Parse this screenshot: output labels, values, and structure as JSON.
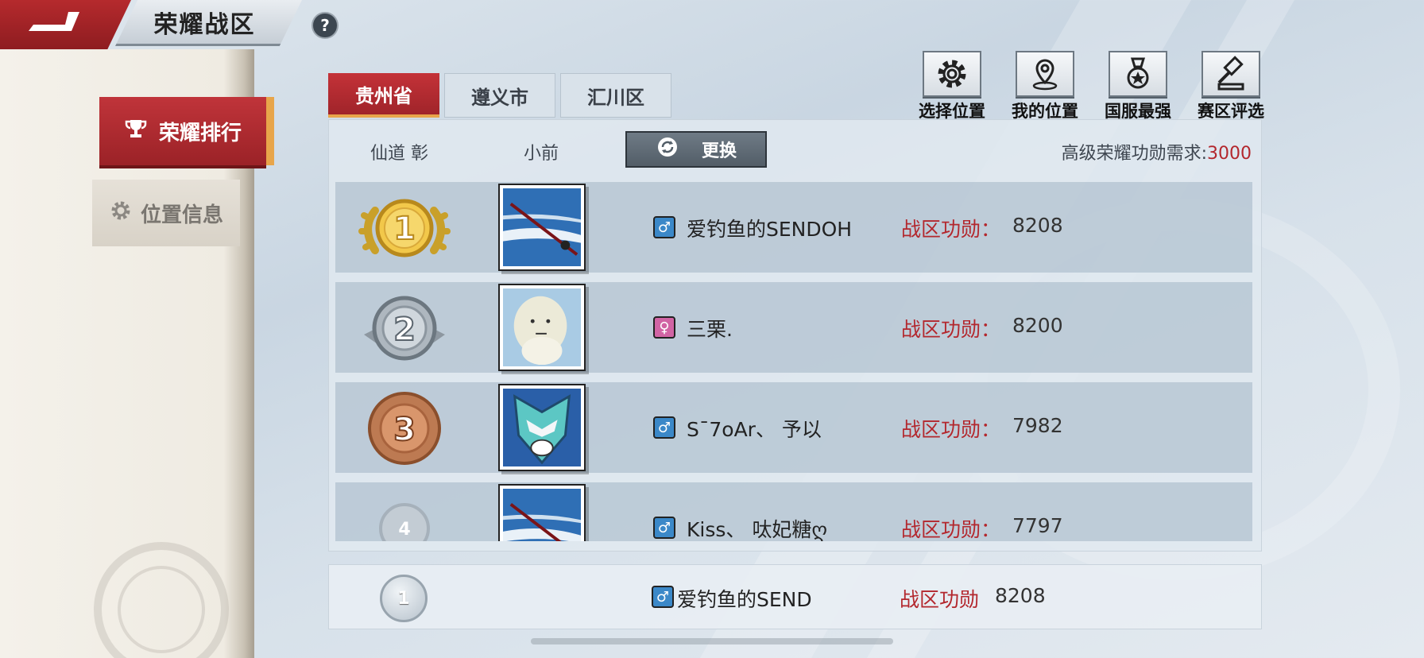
{
  "header": {
    "title": "荣耀战区",
    "help_label": "?"
  },
  "sidebar": {
    "items": [
      {
        "label": "荣耀排行",
        "active": true,
        "icon": "trophy-icon"
      },
      {
        "label": "位置信息",
        "active": false,
        "icon": "gear-icon"
      }
    ]
  },
  "region_tabs": [
    {
      "label": "贵州省",
      "active": true
    },
    {
      "label": "遵义市",
      "active": false
    },
    {
      "label": "汇川区",
      "active": false
    }
  ],
  "tools": [
    {
      "label": "选择位置",
      "icon": "gear-icon"
    },
    {
      "label": "我的位置",
      "icon": "location-pin-icon"
    },
    {
      "label": "国服最强",
      "icon": "medal-icon"
    },
    {
      "label": "赛区评选",
      "icon": "gavel-icon"
    }
  ],
  "list_header": {
    "col1": "仙道 彰",
    "col2": "小前",
    "swap_label": "更换",
    "requirement_label": "高级荣耀功勋需求:",
    "requirement_value": "3000"
  },
  "rankings": [
    {
      "rank": "1",
      "name": "爱钓鱼的SENDOH",
      "gender": "male",
      "merit_label": "战区功勋：",
      "merit": "8208",
      "medal_color": "gold"
    },
    {
      "rank": "2",
      "name": "三栗.",
      "gender": "female",
      "merit_label": "战区功勋：",
      "merit": "8200",
      "medal_color": "silver"
    },
    {
      "rank": "3",
      "name": "S¯7oAr、 予以",
      "gender": "male",
      "merit_label": "战区功勋：",
      "merit": "7982",
      "medal_color": "bronze"
    },
    {
      "rank": "4",
      "name": "Kiss、 呔妃糖ღ",
      "gender": "male",
      "merit_label": "战区功勋：",
      "merit": "7797",
      "medal_color": "plain"
    }
  ],
  "my_rank": {
    "rank": "1",
    "name": "爱钓鱼的SEND",
    "gender": "male",
    "merit_label": "战区功勋",
    "merit": "8208"
  },
  "colors": {
    "accent_red": "#b3272d",
    "male_badge": "#3b88c8",
    "female_badge": "#d164a4"
  }
}
